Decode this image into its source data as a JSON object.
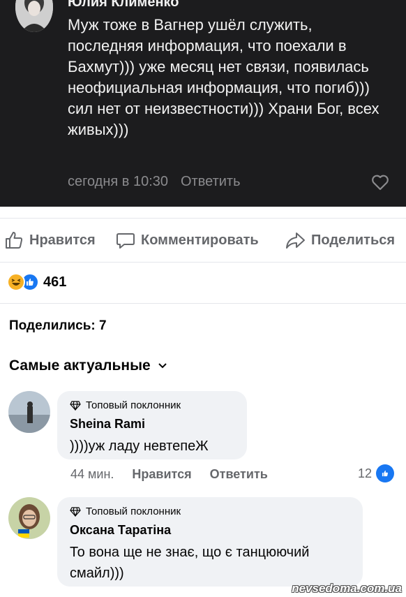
{
  "embedded_comment": {
    "author": "Юлия Клименко",
    "text": "Муж тоже в Вагнер ушёл служить, последняя информация, что поехали в Бахмут))) уже месяц нет связи, появилась неофициальная информация, что погиб))) сил нет от неизвестности))) Храни Бог, всех живых)))",
    "time": "сегодня в 10:30",
    "reply_label": "Ответить",
    "heart_icon": "heart-outline-icon"
  },
  "actions": {
    "like_label": "Нравится",
    "comment_label": "Комментировать",
    "share_label": "Поделиться"
  },
  "reactions": {
    "icons": [
      "haha-reaction-icon",
      "like-reaction-icon"
    ],
    "count": "461"
  },
  "shares_text": "Поделились: 7",
  "sort_label": "Самые актуальные",
  "comments": [
    {
      "badge": "Топовый поклонник",
      "author": "Sheina Rami",
      "text": "))))уж ладу невтепеЖ",
      "time": "44 мин.",
      "like_label": "Нравится",
      "reply_label": "Ответить",
      "likes": "12"
    },
    {
      "badge": "Топовый поклонник",
      "author": "Оксана Таратіна",
      "text": "То вона ще не знає, що є танцюючий смайл)))"
    }
  ],
  "watermark": "nevsedoma.com.ua",
  "colors": {
    "dark_bg": "#1c1c1e",
    "accent_blue": "#1877f2",
    "bubble_bg": "#f0f2f5",
    "muted_text": "#65676b"
  }
}
